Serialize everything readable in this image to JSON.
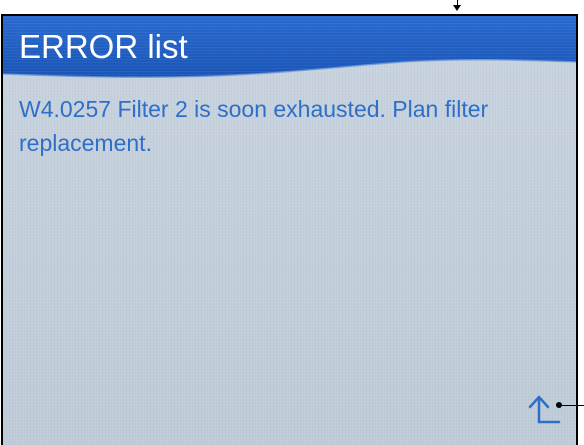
{
  "header": {
    "title": "ERROR list"
  },
  "error": {
    "message": "W4.0257 Filter 2 is soon exhausted. Plan filter replacement."
  },
  "controls": {
    "up_icon": "arrow-up-left-icon"
  },
  "colors": {
    "header_blue": "#1f5fc3",
    "text_blue": "#2e6fc8",
    "screen_bg": "#c5d1dd"
  }
}
